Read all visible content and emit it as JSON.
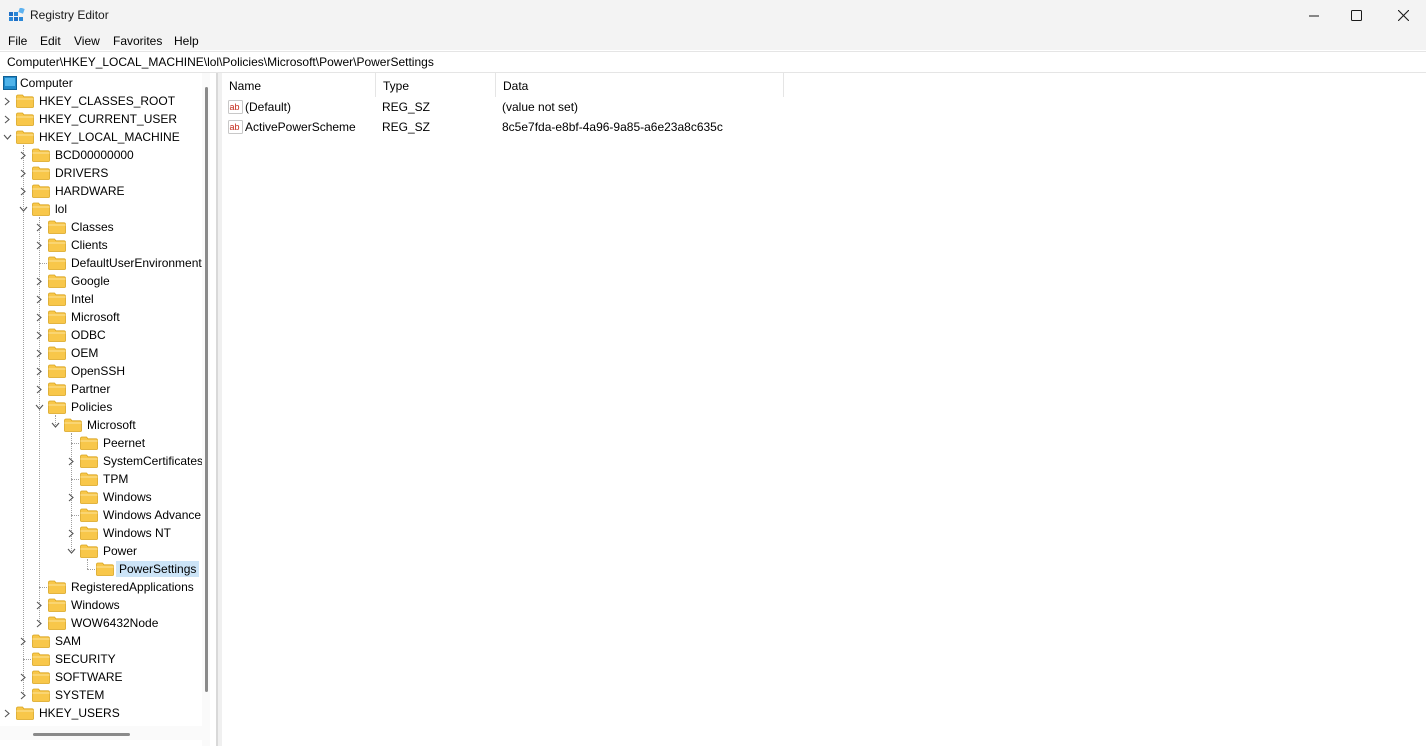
{
  "window": {
    "title": "Registry Editor",
    "icon": "registry-editor-icon",
    "controls": [
      "minimize-icon",
      "maximize-icon",
      "close-icon"
    ]
  },
  "menu": [
    "File",
    "Edit",
    "View",
    "Favorites",
    "Help"
  ],
  "address": "Computer\\HKEY_LOCAL_MACHINE\\lol\\Policies\\Microsoft\\Power\\PowerSettings",
  "tree": [
    {
      "label": "Computer",
      "level": 0,
      "chevron": "none",
      "icon": "computer-icon"
    },
    {
      "label": "HKEY_CLASSES_ROOT",
      "level": 1,
      "chevron": "collapsed"
    },
    {
      "label": "HKEY_CURRENT_USER",
      "level": 1,
      "chevron": "collapsed"
    },
    {
      "label": "HKEY_LOCAL_MACHINE",
      "level": 1,
      "chevron": "expanded"
    },
    {
      "label": "BCD00000000",
      "level": 2,
      "chevron": "collapsed"
    },
    {
      "label": "DRIVERS",
      "level": 2,
      "chevron": "collapsed"
    },
    {
      "label": "HARDWARE",
      "level": 2,
      "chevron": "collapsed"
    },
    {
      "label": "lol",
      "level": 2,
      "chevron": "expanded"
    },
    {
      "label": "Classes",
      "level": 3,
      "chevron": "collapsed"
    },
    {
      "label": "Clients",
      "level": 3,
      "chevron": "collapsed"
    },
    {
      "label": "DefaultUserEnvironment",
      "level": 3,
      "chevron": "none"
    },
    {
      "label": "Google",
      "level": 3,
      "chevron": "collapsed"
    },
    {
      "label": "Intel",
      "level": 3,
      "chevron": "collapsed"
    },
    {
      "label": "Microsoft",
      "level": 3,
      "chevron": "collapsed"
    },
    {
      "label": "ODBC",
      "level": 3,
      "chevron": "collapsed"
    },
    {
      "label": "OEM",
      "level": 3,
      "chevron": "collapsed"
    },
    {
      "label": "OpenSSH",
      "level": 3,
      "chevron": "collapsed"
    },
    {
      "label": "Partner",
      "level": 3,
      "chevron": "collapsed"
    },
    {
      "label": "Policies",
      "level": 3,
      "chevron": "expanded"
    },
    {
      "label": "Microsoft",
      "level": 4,
      "chevron": "expanded"
    },
    {
      "label": "Peernet",
      "level": 5,
      "chevron": "none"
    },
    {
      "label": "SystemCertificates",
      "level": 5,
      "chevron": "collapsed"
    },
    {
      "label": "TPM",
      "level": 5,
      "chevron": "none"
    },
    {
      "label": "Windows",
      "level": 5,
      "chevron": "collapsed"
    },
    {
      "label": "Windows Advance",
      "level": 5,
      "chevron": "none"
    },
    {
      "label": "Windows NT",
      "level": 5,
      "chevron": "collapsed"
    },
    {
      "label": "Power",
      "level": 5,
      "chevron": "expanded"
    },
    {
      "label": "PowerSettings",
      "level": 6,
      "chevron": "none",
      "selected": true
    },
    {
      "label": "RegisteredApplications",
      "level": 3,
      "chevron": "none"
    },
    {
      "label": "Windows",
      "level": 3,
      "chevron": "collapsed"
    },
    {
      "label": "WOW6432Node",
      "level": 3,
      "chevron": "collapsed"
    },
    {
      "label": "SAM",
      "level": 2,
      "chevron": "collapsed"
    },
    {
      "label": "SECURITY",
      "level": 2,
      "chevron": "none"
    },
    {
      "label": "SOFTWARE",
      "level": 2,
      "chevron": "collapsed"
    },
    {
      "label": "SYSTEM",
      "level": 2,
      "chevron": "collapsed"
    },
    {
      "label": "HKEY_USERS",
      "level": 1,
      "chevron": "collapsed"
    }
  ],
  "list": {
    "columns": [
      "Name",
      "Type",
      "Data"
    ],
    "rows": [
      {
        "name": "(Default)",
        "type": "REG_SZ",
        "data": "(value not set)",
        "icon": "string-value-icon"
      },
      {
        "name": "ActivePowerScheme",
        "type": "REG_SZ",
        "data": "8c5e7fda-e8bf-4a96-9a85-a6e23a8c635c",
        "icon": "string-value-icon"
      }
    ]
  },
  "colors": {
    "selection": "#cce4f7",
    "folder": "#f8c74a",
    "accent": "#0078d4"
  }
}
